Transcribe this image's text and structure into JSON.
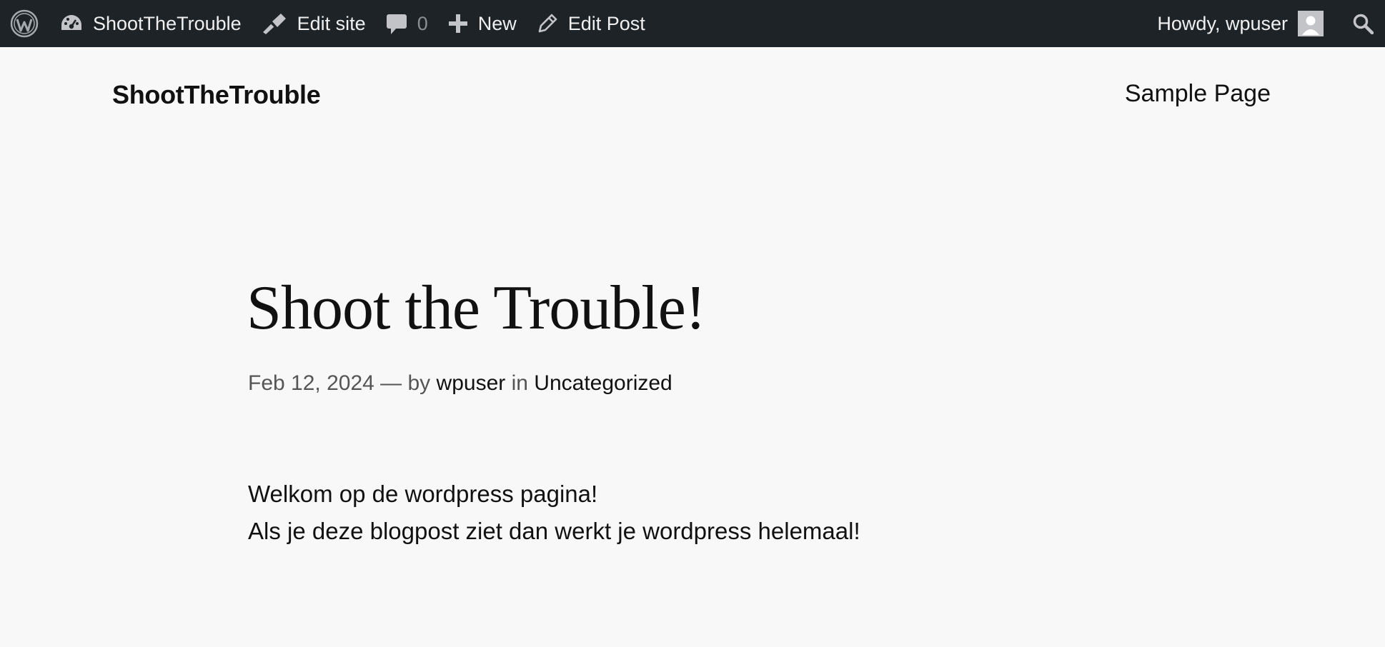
{
  "adminbar": {
    "site_name": "ShootTheTrouble",
    "edit_site": "Edit site",
    "comments_count": "0",
    "new_label": "New",
    "edit_post": "Edit Post",
    "howdy": "Howdy, wpuser",
    "icons": {
      "wordpress": "wordpress-logo-icon",
      "dashboard": "dashboard-icon",
      "edit_site": "brush-icon",
      "comments": "comment-bubble-icon",
      "new": "plus-icon",
      "edit_post": "pencil-icon",
      "avatar": "user-avatar-icon",
      "search": "search-icon"
    }
  },
  "header": {
    "site_title": "ShootTheTrouble",
    "nav_item": "Sample Page"
  },
  "post": {
    "title": "Shoot the Trouble!",
    "date": "Feb 12, 2024",
    "dash_by": "— by",
    "author": "wpuser",
    "in": "in",
    "category": "Uncategorized",
    "content_line1": "Welkom op de wordpress pagina!",
    "content_line2": "Als je deze blogpost ziet dan werkt je wordpress helemaal!"
  },
  "colors": {
    "adminbar_bg": "#1d2327",
    "page_bg": "#f8f8f8",
    "text": "#111111",
    "muted": "#555555"
  }
}
